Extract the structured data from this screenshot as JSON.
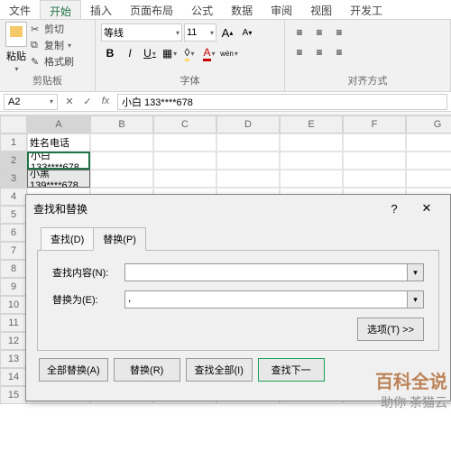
{
  "ribbon_tabs": [
    "文件",
    "开始",
    "插入",
    "页面布局",
    "公式",
    "数据",
    "审阅",
    "视图",
    "开发工"
  ],
  "active_tab": 1,
  "clipboard": {
    "paste": "粘贴",
    "cut": "剪切",
    "copy": "复制",
    "format_painter": "格式刷",
    "group": "剪贴板"
  },
  "font": {
    "name": "等线",
    "size": "11",
    "bold": "B",
    "italic": "I",
    "underline": "U",
    "group": "字体",
    "increase": "A",
    "decrease": "A"
  },
  "align": {
    "group": "对齐方式"
  },
  "cellref": {
    "name_box": "A2",
    "formula": "小白 133****678"
  },
  "columns": [
    "",
    "A",
    "B",
    "C",
    "D",
    "E",
    "F",
    "G"
  ],
  "rows": [
    {
      "n": "1",
      "cells": [
        "姓名电话",
        "",
        "",
        "",
        "",
        "",
        ""
      ]
    },
    {
      "n": "2",
      "cells": [
        "小白 133****678",
        "",
        "",
        "",
        "",
        "",
        ""
      ]
    },
    {
      "n": "3",
      "cells": [
        "小黑 139****678",
        "",
        "",
        "",
        "",
        "",
        ""
      ]
    },
    {
      "n": "4",
      "cells": [
        "",
        "",
        "",
        "",
        "",
        "",
        ""
      ]
    },
    {
      "n": "5",
      "cells": [
        "",
        "",
        "",
        "",
        "",
        "",
        ""
      ]
    },
    {
      "n": "6",
      "cells": [
        "",
        "",
        "",
        "",
        "",
        "",
        ""
      ]
    },
    {
      "n": "7",
      "cells": [
        "",
        "",
        "",
        "",
        "",
        "",
        ""
      ]
    },
    {
      "n": "8",
      "cells": [
        "",
        "",
        "",
        "",
        "",
        "",
        ""
      ]
    },
    {
      "n": "9",
      "cells": [
        "",
        "",
        "",
        "",
        "",
        "",
        ""
      ]
    },
    {
      "n": "10",
      "cells": [
        "",
        "",
        "",
        "",
        "",
        "",
        ""
      ]
    },
    {
      "n": "11",
      "cells": [
        "",
        "",
        "",
        "",
        "",
        "",
        ""
      ]
    },
    {
      "n": "12",
      "cells": [
        "",
        "",
        "",
        "",
        "",
        "",
        ""
      ]
    },
    {
      "n": "13",
      "cells": [
        "",
        "",
        "",
        "",
        "",
        "",
        ""
      ]
    },
    {
      "n": "14",
      "cells": [
        "",
        "",
        "",
        "",
        "",
        "",
        ""
      ]
    },
    {
      "n": "15",
      "cells": [
        "",
        "",
        "",
        "",
        "",
        "",
        ""
      ]
    }
  ],
  "dialog": {
    "title": "查找和替换",
    "tabs": [
      "查找(D)",
      "替换(P)"
    ],
    "active_tab": 1,
    "find_label": "查找内容(N):",
    "replace_label": "替换为(E):",
    "find_value": "",
    "replace_value": ",",
    "options_btn": "选项(T) >>",
    "buttons": [
      "全部替换(A)",
      "替换(R)",
      "查找全部(I)",
      "查找下一"
    ]
  },
  "watermark": {
    "title": "百科全说",
    "sub": "茶猫云",
    "tag": "助你"
  }
}
